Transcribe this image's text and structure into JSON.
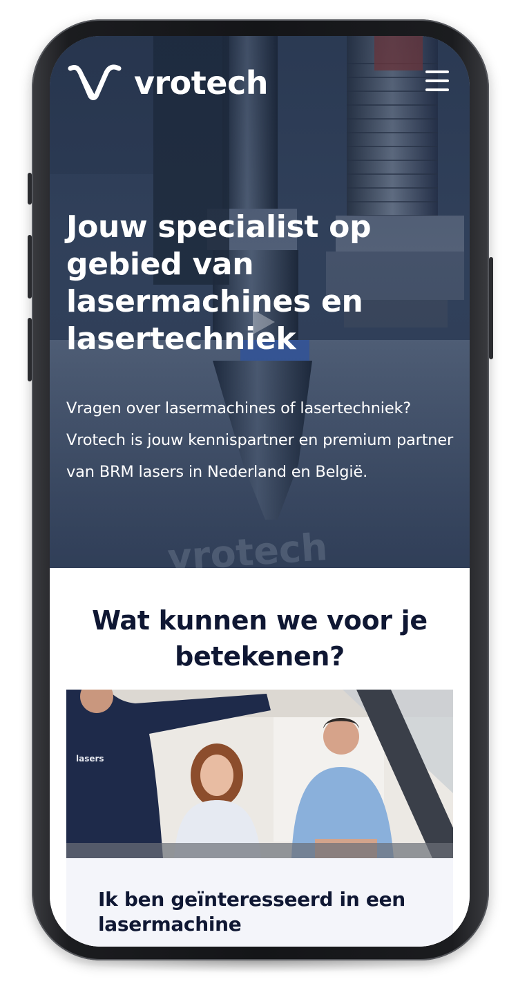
{
  "header": {
    "logo_text": "vrotech",
    "menu_icon": "hamburger-menu-icon"
  },
  "hero": {
    "title": "Jouw specialist op gebied van lasermachines en lasertechniek",
    "text": "Vragen over lasermachines of lasertechniek? Vrotech is jouw kennispartner en premium partner van BRM lasers in Nederland en België.",
    "play_icon": "play-icon"
  },
  "services": {
    "title": "Wat kunnen we voor je betekenen?",
    "cards": [
      {
        "title": "Ik ben geïnteresseerd in een lasermachine"
      }
    ]
  },
  "colors": {
    "heading_dark": "#0f1733",
    "hero_overlay": "#2b3a52",
    "card_background": "#f4f5fa",
    "white": "#ffffff"
  }
}
